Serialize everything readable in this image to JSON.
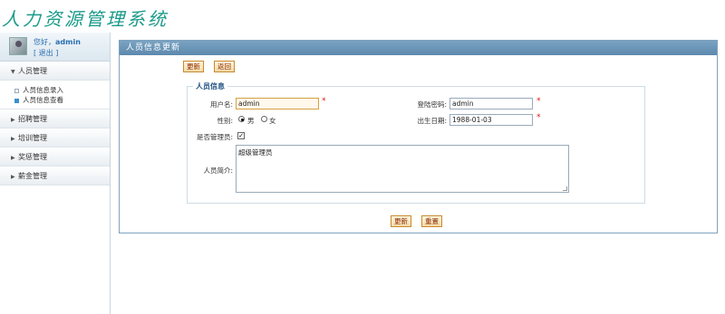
{
  "app": {
    "logo_text": "人力资源管理系统"
  },
  "user": {
    "greeting_prefix": "您好，",
    "name": "admin",
    "logout": "[ 退出 ]"
  },
  "menu": {
    "groups": [
      {
        "label": "人员管理",
        "expanded": true,
        "items": [
          {
            "label": "人员信息录入",
            "active": false
          },
          {
            "label": "人员信息查看",
            "active": true
          }
        ]
      },
      {
        "label": "招聘管理",
        "expanded": false
      },
      {
        "label": "培训管理",
        "expanded": false
      },
      {
        "label": "奖惩管理",
        "expanded": false
      },
      {
        "label": "薪金管理",
        "expanded": false
      }
    ]
  },
  "panel": {
    "title": "人员信息更新",
    "top_buttons": {
      "update": "更新",
      "back": "返回"
    },
    "fieldset_legend": "人员信息",
    "fields": {
      "username_label": "用户名:",
      "username_value": "admin",
      "password_label": "登陆密码:",
      "password_value": "admin",
      "gender_label": "性别:",
      "gender_male": "男",
      "gender_female": "女",
      "gender_selected": "男",
      "birthdate_label": "出生日期:",
      "birthdate_value": "1988-01-03",
      "is_admin_label": "是否管理员:",
      "is_admin_checked": true,
      "bio_label": "人员简介:",
      "bio_value": "超级管理员",
      "required_mark": "*"
    },
    "bottom_buttons": {
      "update": "更新",
      "reset": "重置"
    }
  },
  "colors": {
    "panel_title_bg": "#6a93b5",
    "logo": "#1a9a8a",
    "required": "#e01010",
    "button_text": "#8a2a00"
  }
}
